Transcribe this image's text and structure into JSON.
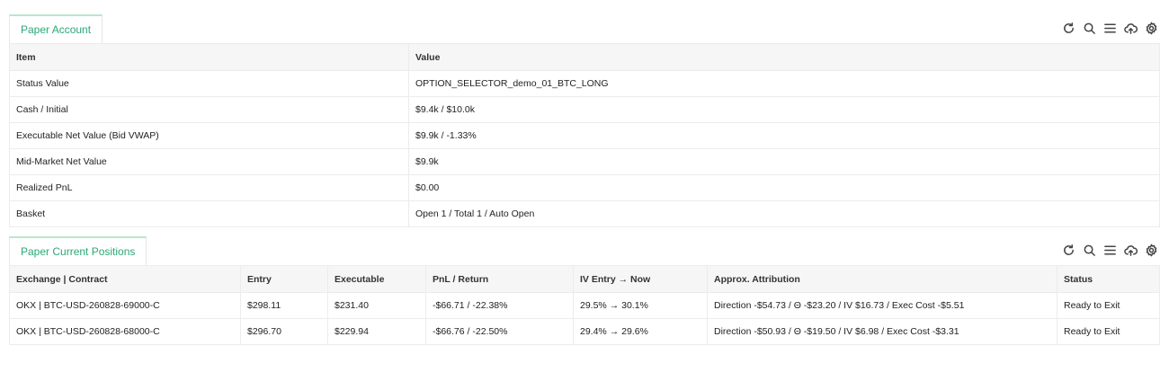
{
  "account": {
    "tab_label": "Paper Account",
    "columns": [
      "Item",
      "Value"
    ],
    "rows": [
      [
        "Status Value",
        "OPTION_SELECTOR_demo_01_BTC_LONG"
      ],
      [
        "Cash / Initial",
        "$9.4k / $10.0k"
      ],
      [
        "Executable Net Value (Bid VWAP)",
        "$9.9k / -1.33%"
      ],
      [
        "Mid-Market Net Value",
        "$9.9k"
      ],
      [
        "Realized PnL",
        "$0.00"
      ],
      [
        "Basket",
        "Open 1 / Total 1 / Auto Open"
      ]
    ]
  },
  "positions": {
    "tab_label": "Paper Current Positions",
    "columns": [
      "Exchange | Contract",
      "Entry",
      "Executable",
      "PnL / Return",
      "IV Entry → Now",
      "Approx. Attribution",
      "Status"
    ],
    "rows": [
      [
        "OKX | BTC-USD-260828-69000-C",
        "$298.11",
        "$231.40",
        "-$66.71 / -22.38%",
        "29.5% → 30.1%",
        "Direction -$54.73 / Θ -$23.20 / IV $16.73 / Exec Cost -$5.51",
        "Ready to Exit"
      ],
      [
        "OKX | BTC-USD-260828-68000-C",
        "$296.70",
        "$229.94",
        "-$66.76 / -22.50%",
        "29.4% → 29.6%",
        "Direction -$50.93 / Θ -$19.50 / IV $6.98 / Exec Cost -$3.31",
        "Ready to Exit"
      ]
    ]
  },
  "toolbar_icons": [
    "refresh-icon",
    "search-icon",
    "list-icon",
    "cloud-upload-icon",
    "gear-icon"
  ],
  "colors": {
    "accent": "#2aa876",
    "header_bg": "#f6f6f6",
    "border": "#ececec"
  }
}
